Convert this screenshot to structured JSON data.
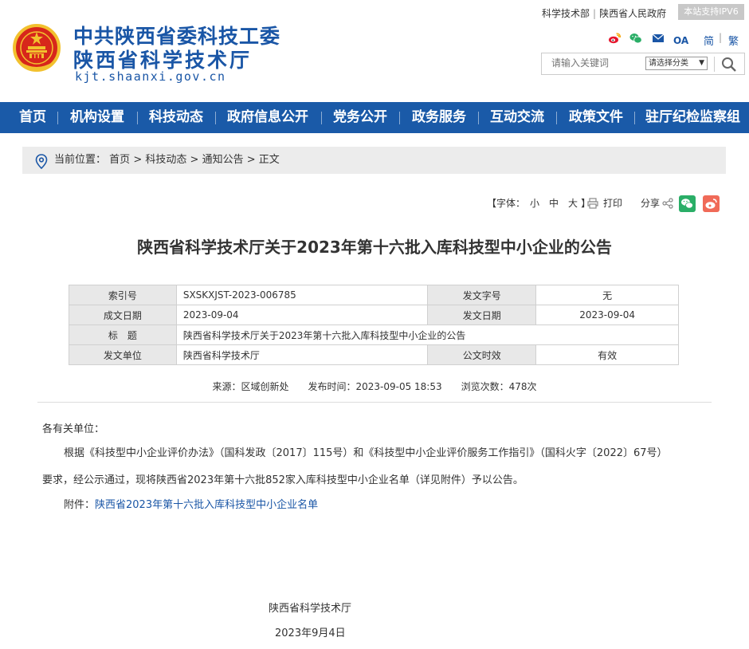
{
  "site": {
    "name_line1": "中共陕西省委科技工委",
    "name_line2": "陕西省科学技术厅",
    "domain": "kjt.shaanxi.gov.cn"
  },
  "top_links": {
    "link1": "科学技术部",
    "link2": "陕西省人民政府",
    "ipv6_badge": "本站支持IPV6"
  },
  "social_icons": [
    "weibo-icon",
    "wechat-icon",
    "mail-icon",
    "oa-icon"
  ],
  "social_oa_label": "OA",
  "lang": {
    "simplified": "简",
    "traditional": "繁"
  },
  "search": {
    "placeholder": "请输入关键词",
    "category": "请选择分类"
  },
  "nav": {
    "items": [
      "首页",
      "机构设置",
      "科技动态",
      "政府信息公开",
      "党务公开",
      "政务服务",
      "互动交流",
      "政策文件",
      "驻厅纪检监察组"
    ]
  },
  "breadcrumb": {
    "label": "当前位置：",
    "items": [
      "首页",
      "科技动态",
      "通知公告",
      "正文"
    ],
    "sep": ">"
  },
  "tools": {
    "font_open": "【字体：",
    "font_small": "小",
    "font_medium": "中",
    "font_large": "大",
    "font_close": "】",
    "print": "打印",
    "share": "分享"
  },
  "article": {
    "title": "陕西省科学技术厅关于2023年第十六批入库科技型中小企业的公告",
    "meta": {
      "index_label": "索引号",
      "index_value": "SXSKXJST-2023-006785",
      "doc_no_label": "发文字号",
      "doc_no_value": "无",
      "written_label": "成文日期",
      "written_value": "2023-09-04",
      "issued_label": "发文日期",
      "issued_value": "2023-09-04",
      "title_label": "标　题",
      "title_value": "陕西省科学技术厅关于2023年第十六批入库科技型中小企业的公告",
      "issuer_label": "发文单位",
      "issuer_value": "陕西省科学技术厅",
      "validity_label": "公文时效",
      "validity_value": "有效"
    },
    "source_line": "来源：区域创新处　　发布时间：2023-09-05 18:53　　浏览次数：478次",
    "salutation": "各有关单位：",
    "para1_line1": "根据《科技型中小企业评价办法》（国科发政〔2017〕115号）和《科技型中小企业评价服务工作指引》（国科火字〔2022〕67号）",
    "para1_line2": "要求，经公示通过，现将陕西省2023年第十六批852家入库科技型中小企业名单（详见附件）予以公告。",
    "attachment_label": "附件：",
    "attachment_link": "陕西省2023年第十六批入库科技型中小企业名单",
    "signature": "陕西省科学技术厅",
    "date": "2023年9月4日"
  },
  "colors": {
    "brand_blue": "#1a5aa8",
    "title_blue": "#1a56a6",
    "emblem_red": "#d7261b",
    "emblem_gold": "#f2c12e"
  }
}
